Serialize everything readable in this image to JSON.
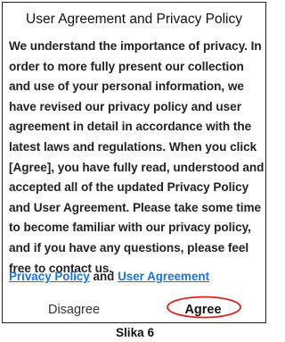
{
  "dialog": {
    "title": "User Agreement and Privacy Policy",
    "body": "We understand the importance of privacy. In order to more fully present our collection and use of your personal information, we have revised our privacy policy and user agreement in detail in accordance with the latest laws and regulations. When you click [Agree], you have fully read, understood and accepted all of the updated Privacy Policy and User Agreement. Please take some time to become familiar with our privacy policy, and if you have any questions, please feel free to contact us.",
    "links": {
      "privacy_policy": "Privacy Policy",
      "connector": " and ",
      "user_agreement": "User Agreement"
    },
    "buttons": {
      "disagree": "Disagree",
      "agree": "Agree"
    }
  },
  "highlight_color": "#e02020",
  "link_color": "#1a73e8",
  "caption": "Slika 6"
}
